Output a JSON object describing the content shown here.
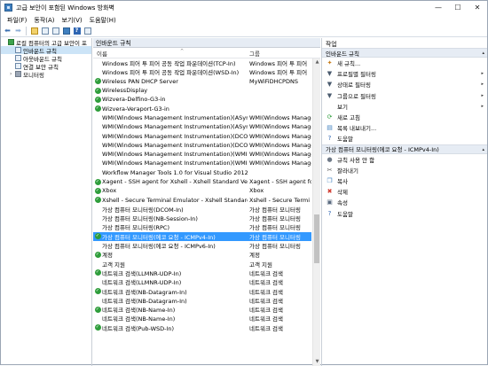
{
  "window": {
    "title": "고급 보안이 포함된 Windows 방화벽",
    "minimize": "—",
    "maximize": "☐",
    "close": "✕"
  },
  "menu": [
    "파일(F)",
    "동작(A)",
    "보기(V)",
    "도움말(H)"
  ],
  "toolbar": {
    "back": "⬅",
    "forward": "➡",
    "help": "?"
  },
  "tree": [
    {
      "label": "로컬 컴퓨터의 고급 보안이 포",
      "indent": 0,
      "icon": "firewall-icon",
      "sel": false,
      "exp": ""
    },
    {
      "label": "인바운드 규칙",
      "indent": 1,
      "icon": "inbound-rules-icon",
      "sel": true,
      "exp": ""
    },
    {
      "label": "아웃바운드 규칙",
      "indent": 1,
      "icon": "outbound-rules-icon",
      "sel": false,
      "exp": ""
    },
    {
      "label": "연결 보안 규칙",
      "indent": 1,
      "icon": "connection-security-icon",
      "sel": false,
      "exp": ""
    },
    {
      "label": "모니터링",
      "indent": 1,
      "icon": "monitoring-icon",
      "sel": false,
      "exp": "›"
    }
  ],
  "center": {
    "title": "인바운드 규칙",
    "col_name": "이름",
    "col_group": "그룹",
    "sort_caret": "^",
    "rows": [
      {
        "on": false,
        "name": "Windows 피어 투 피어 공동 작업 파운데이션(TCP-In)",
        "group": "Windows 피어 투 피어",
        "sel": false
      },
      {
        "on": false,
        "name": "Windows 피어 투 피어 공동 작업 파운데이션(WSD-In)",
        "group": "Windows 피어 투 피어",
        "sel": false
      },
      {
        "on": true,
        "name": "Wireless PAN DHCP Server",
        "group": "MyWiFiDHCPDNS",
        "sel": false
      },
      {
        "on": true,
        "name": "WirelessDisplay",
        "group": "",
        "sel": false
      },
      {
        "on": true,
        "name": "Wizvera-Delfino-G3-in",
        "group": "",
        "sel": false
      },
      {
        "on": true,
        "name": "Wizvera-Veraport-G3-in",
        "group": "",
        "sel": false
      },
      {
        "on": false,
        "name": "WMI(Windows Management Instrumentation)(ASync-In)",
        "group": "WMI(Windows Manage",
        "sel": false
      },
      {
        "on": false,
        "name": "WMI(Windows Management Instrumentation)(ASync-In)",
        "group": "WMI(Windows Manage",
        "sel": false
      },
      {
        "on": false,
        "name": "WMI(Windows Management Instrumentation)(DCOM-In)",
        "group": "WMI(Windows Manage",
        "sel": false
      },
      {
        "on": false,
        "name": "WMI(Windows Management Instrumentation)(DCOM-In)",
        "group": "WMI(Windows Manage",
        "sel": false
      },
      {
        "on": false,
        "name": "WMI(Windows Management Instrumentation)(WMI-In)",
        "group": "WMI(Windows Manage",
        "sel": false
      },
      {
        "on": false,
        "name": "WMI(Windows Management Instrumentation)(WMI-In)",
        "group": "WMI(Windows Manage",
        "sel": false
      },
      {
        "on": false,
        "name": "Workflow Manager Tools 1.0 for Visual Studio 2012 -...",
        "group": "",
        "sel": false
      },
      {
        "on": true,
        "name": "Xagent - SSH agent for Xshell - Xshell Standard Versio...",
        "group": "Xagent - SSH agent fo",
        "sel": false
      },
      {
        "on": true,
        "name": "Xbox",
        "group": "Xbox",
        "sel": false
      },
      {
        "on": true,
        "name": "Xshell - Secure Terminal Emulator - Xshell Standard Ve...",
        "group": "Xshell - Secure Termi",
        "sel": false
      },
      {
        "on": false,
        "name": "가상 컴퓨터 모니터링(DCOM-In)",
        "group": "가상 컴퓨터 모니터링",
        "sel": false
      },
      {
        "on": false,
        "name": "가상 컴퓨터 모니터링(NB-Session-In)",
        "group": "가상 컴퓨터 모니터링",
        "sel": false
      },
      {
        "on": false,
        "name": "가상 컴퓨터 모니터링(RPC)",
        "group": "가상 컴퓨터 모니터링",
        "sel": false
      },
      {
        "on": true,
        "name": "가상 컴퓨터 모니터링(에코 요청 - ICMPv4-In)",
        "group": "가상 컴퓨터 모니터링",
        "sel": true
      },
      {
        "on": false,
        "name": "가상 컴퓨터 모니터링(에코 요청 - ICMPv6-In)",
        "group": "가상 컴퓨터 모니터링",
        "sel": false
      },
      {
        "on": true,
        "name": "계정",
        "group": "계정",
        "sel": false
      },
      {
        "on": false,
        "name": "고객 지원",
        "group": "고객 지원",
        "sel": false
      },
      {
        "on": true,
        "name": "네트워크 검색(LLMNR-UDP-In)",
        "group": "네트워크 검색",
        "sel": false
      },
      {
        "on": false,
        "name": "네트워크 검색(LLMNR-UDP-In)",
        "group": "네트워크 검색",
        "sel": false
      },
      {
        "on": true,
        "name": "네트워크 검색(NB-Datagram-In)",
        "group": "네트워크 검색",
        "sel": false
      },
      {
        "on": false,
        "name": "네트워크 검색(NB-Datagram-In)",
        "group": "네트워크 검색",
        "sel": false
      },
      {
        "on": true,
        "name": "네트워크 검색(NB-Name-In)",
        "group": "네트워크 검색",
        "sel": false
      },
      {
        "on": false,
        "name": "네트워크 검색(NB-Name-In)",
        "group": "네트워크 검색",
        "sel": false
      },
      {
        "on": true,
        "name": "네트워크 검색(Pub-WSD-In)",
        "group": "네트워크 검색",
        "sel": false
      }
    ]
  },
  "actions": {
    "title": "작업",
    "section1": "인바운드 규칙",
    "items1": [
      {
        "label": "새 규칙...",
        "icon": "new-rule-icon",
        "glyph": "✦",
        "color": "#c77d1a",
        "sub": ""
      },
      {
        "label": "프로필별 필터링",
        "icon": "filter-icon",
        "glyph": "▼",
        "color": "#4a5a6e",
        "sub": "▸"
      },
      {
        "label": "상태로 필터링",
        "icon": "filter-icon",
        "glyph": "▼",
        "color": "#4a5a6e",
        "sub": "▸"
      },
      {
        "label": "그룹으로 필터링",
        "icon": "filter-icon",
        "glyph": "▼",
        "color": "#4a5a6e",
        "sub": "▸"
      },
      {
        "label": "보기",
        "icon": "view-icon",
        "glyph": "",
        "color": "#4a5a6e",
        "sub": "▸"
      },
      {
        "label": "새로 고침",
        "icon": "refresh-icon",
        "glyph": "⟳",
        "color": "#2e9d3b",
        "sub": ""
      },
      {
        "label": "목록 내보내기...",
        "icon": "export-icon",
        "glyph": "▤",
        "color": "#3f7fbf",
        "sub": ""
      },
      {
        "label": "도움말",
        "icon": "help-icon",
        "glyph": "?",
        "color": "#2f66b3",
        "sub": ""
      }
    ],
    "section2": "가상 컴퓨터 모니터링(에코 요청 - ICMPv4-In)",
    "items2": [
      {
        "label": "규칙 사용 안 함",
        "icon": "disable-rule-icon",
        "glyph": "●",
        "color": "#6f7a88",
        "sub": ""
      },
      {
        "label": "잘라내기",
        "icon": "cut-icon",
        "glyph": "✂",
        "color": "#555555",
        "sub": ""
      },
      {
        "label": "복사",
        "icon": "copy-icon",
        "glyph": "❐",
        "color": "#3f7fbf",
        "sub": ""
      },
      {
        "label": "삭제",
        "icon": "delete-icon",
        "glyph": "✖",
        "color": "#d03a2f",
        "sub": ""
      },
      {
        "label": "속성",
        "icon": "properties-icon",
        "glyph": "▣",
        "color": "#5a6b80",
        "sub": ""
      },
      {
        "label": "도움말",
        "icon": "help-icon",
        "glyph": "?",
        "color": "#2f66b3",
        "sub": ""
      }
    ],
    "caret": "▴"
  }
}
